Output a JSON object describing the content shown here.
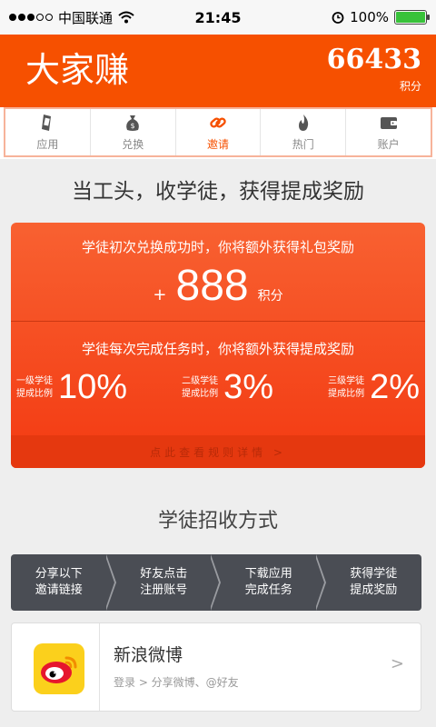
{
  "status_bar": {
    "carrier": "中国联通",
    "time": "21:45",
    "battery": "100%",
    "battery_level": 1.0
  },
  "header": {
    "title": "大家赚",
    "points": "66433",
    "points_label": "积分"
  },
  "tabs": [
    {
      "label": "应用",
      "icon": "phone-icon"
    },
    {
      "label": "兑换",
      "icon": "money-bag-icon"
    },
    {
      "label": "邀请",
      "icon": "link-icon"
    },
    {
      "label": "热门",
      "icon": "flame-icon"
    },
    {
      "label": "账户",
      "icon": "wallet-icon"
    }
  ],
  "active_tab": "邀请",
  "slogan": "当工头，收学徒，获得提成奖励",
  "reward_card": {
    "line1": "学徒初次兑换成功时，你将额外获得礼包奖励",
    "plus": "+",
    "amount": "888",
    "unit": "积分",
    "line2": "学徒每次完成任务时，你将额外获得提成奖励",
    "rates": [
      {
        "label_top": "一级学徒",
        "label_bottom": "提成比例",
        "value": "10%"
      },
      {
        "label_top": "二级学徒",
        "label_bottom": "提成比例",
        "value": "3%"
      },
      {
        "label_top": "三级学徒",
        "label_bottom": "提成比例",
        "value": "2%"
      }
    ],
    "footer": "点此查看规则详情 >"
  },
  "recruit_title": "学徒招收方式",
  "steps": [
    {
      "line1": "分享以下",
      "line2": "邀请链接"
    },
    {
      "line1": "好友点击",
      "line2": "注册账号"
    },
    {
      "line1": "下载应用",
      "line2": "完成任务"
    },
    {
      "line1": "获得学徒",
      "line2": "提成奖励"
    }
  ],
  "share": {
    "title": "新浪微博",
    "subtitle": "登录 > 分享微博、@好友",
    "arrow": ">",
    "icon": "weibo-icon"
  },
  "colors": {
    "brand": "#f65000",
    "card": "#f33a12",
    "steps": "#4a4d54"
  }
}
